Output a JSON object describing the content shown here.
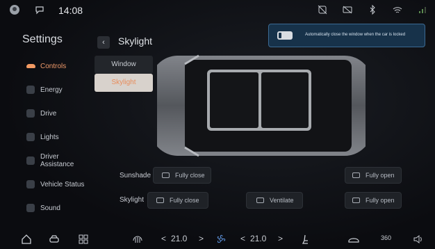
{
  "status_bar": {
    "time": "14:08"
  },
  "sidebar": {
    "title": "Settings",
    "items": [
      {
        "label": "Controls",
        "active": true
      },
      {
        "label": "Energy"
      },
      {
        "label": "Drive"
      },
      {
        "label": "Lights"
      },
      {
        "label": "Driver Assistance"
      },
      {
        "label": "Vehicle Status"
      },
      {
        "label": "Sound"
      }
    ]
  },
  "header": {
    "back_icon": "chevron-left-icon",
    "title": "Skylight"
  },
  "subtabs": [
    {
      "label": "Window"
    },
    {
      "label": "Skylight",
      "selected": true
    }
  ],
  "toast": {
    "message": "Automatically close the window when the car is locked"
  },
  "sunshade": {
    "label": "Sunshade",
    "buttons": [
      {
        "label": "Fully close"
      },
      {
        "label": "Fully open"
      }
    ]
  },
  "skylight": {
    "label": "Skylight",
    "buttons": [
      {
        "label": "Fully close"
      },
      {
        "label": "Ventilate"
      },
      {
        "label": "Fully open"
      }
    ]
  },
  "dock": {
    "left_temp": "21.0",
    "right_temp": "21.0",
    "prev_arrow": "<",
    "next_arrow": ">",
    "view_360": "360"
  },
  "colors": {
    "accent": "#f29a63",
    "toast_bg": "#17324a"
  }
}
